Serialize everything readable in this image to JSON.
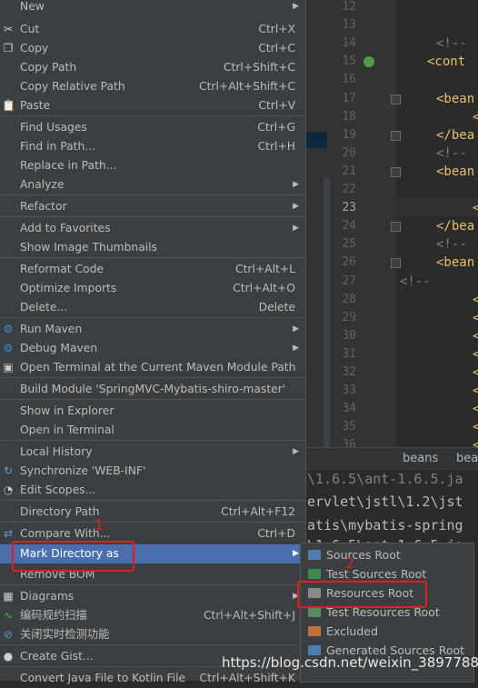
{
  "colors": {
    "menu_bg": "#3c3f41",
    "selection": "#4b6eaf",
    "highlight": "#e02020",
    "editor_bg": "#2b2b2b",
    "tag": "#e8bf6a",
    "comment": "#808080"
  },
  "editor": {
    "line_numbers": [
      "12",
      "13",
      "14",
      "15",
      "16",
      "17",
      "18",
      "19",
      "20",
      "21",
      "22",
      "23",
      "24",
      "25",
      "26",
      "27",
      "28",
      "29",
      "30",
      "31",
      "32",
      "33",
      "34",
      "35",
      "36"
    ],
    "lines": [
      "",
      "",
      "<!--",
      "<cont",
      "",
      "<bean",
      "<",
      "</bea",
      "<!--",
      "<bean",
      "",
      "<",
      "</bea",
      "<!--",
      "<bean",
      "<!--",
      "<",
      "<",
      "<",
      "<",
      "<",
      "<",
      "<",
      "<",
      "<"
    ]
  },
  "breadcrumb": {
    "items": [
      "beans",
      "bear"
    ]
  },
  "console": {
    "lines": [
      "\\1.6.5\\ant-1.6.5.ja",
      "ervlet\\jstl\\1.2\\jst",
      "atis\\mybatis-spring",
      "\\1.6.5\\ant-1.6.5.ja"
    ]
  },
  "menu": {
    "items": [
      {
        "label": "New",
        "shortcut": "",
        "arrow": true,
        "icon": ""
      },
      {
        "label": "Cut",
        "shortcut": "Ctrl+X",
        "arrow": false,
        "icon": "scissors-icon"
      },
      {
        "label": "Copy",
        "shortcut": "Ctrl+C",
        "arrow": false,
        "icon": "copy-icon"
      },
      {
        "label": "Copy Path",
        "shortcut": "Ctrl+Shift+C",
        "arrow": false,
        "icon": ""
      },
      {
        "label": "Copy Relative Path",
        "shortcut": "Ctrl+Alt+Shift+C",
        "arrow": false,
        "icon": ""
      },
      {
        "label": "Paste",
        "shortcut": "Ctrl+V",
        "arrow": false,
        "icon": "paste-icon"
      },
      {
        "label": "Find Usages",
        "shortcut": "Ctrl+G",
        "arrow": false,
        "icon": ""
      },
      {
        "label": "Find in Path...",
        "shortcut": "Ctrl+H",
        "arrow": false,
        "icon": ""
      },
      {
        "label": "Replace in Path...",
        "shortcut": "",
        "arrow": false,
        "icon": ""
      },
      {
        "label": "Analyze",
        "shortcut": "",
        "arrow": true,
        "icon": ""
      },
      {
        "label": "Refactor",
        "shortcut": "",
        "arrow": true,
        "icon": ""
      },
      {
        "label": "Add to Favorites",
        "shortcut": "",
        "arrow": true,
        "icon": ""
      },
      {
        "label": "Show Image Thumbnails",
        "shortcut": "",
        "arrow": false,
        "icon": ""
      },
      {
        "label": "Reformat Code",
        "shortcut": "Ctrl+Alt+L",
        "arrow": false,
        "icon": ""
      },
      {
        "label": "Optimize Imports",
        "shortcut": "Ctrl+Alt+O",
        "arrow": false,
        "icon": ""
      },
      {
        "label": "Delete...",
        "shortcut": "Delete",
        "arrow": false,
        "icon": ""
      },
      {
        "label": "Run Maven",
        "shortcut": "",
        "arrow": true,
        "icon": "maven-gear-icon"
      },
      {
        "label": "Debug Maven",
        "shortcut": "",
        "arrow": true,
        "icon": "maven-gear-icon"
      },
      {
        "label": "Open Terminal at the Current Maven Module Path",
        "shortcut": "",
        "arrow": false,
        "icon": "terminal-icon"
      },
      {
        "label": "Build Module 'SpringMVC-Mybatis-shiro-master'",
        "shortcut": "",
        "arrow": false,
        "icon": ""
      },
      {
        "label": "Show in Explorer",
        "shortcut": "",
        "arrow": false,
        "icon": ""
      },
      {
        "label": "Open in Terminal",
        "shortcut": "",
        "arrow": false,
        "icon": ""
      },
      {
        "label": "Local History",
        "shortcut": "",
        "arrow": true,
        "icon": ""
      },
      {
        "label": "Synchronize 'WEB-INF'",
        "shortcut": "",
        "arrow": false,
        "icon": "sync-icon"
      },
      {
        "label": "Edit Scopes...",
        "shortcut": "",
        "arrow": false,
        "icon": "edit-scopes-icon"
      },
      {
        "label": "Directory Path",
        "shortcut": "Ctrl+Alt+F12",
        "arrow": false,
        "icon": ""
      },
      {
        "label": "Compare With...",
        "shortcut": "Ctrl+D",
        "arrow": false,
        "icon": "compare-icon"
      },
      {
        "label": "Mark Directory as",
        "shortcut": "",
        "arrow": true,
        "icon": ""
      },
      {
        "label": "Remove BOM",
        "shortcut": "",
        "arrow": false,
        "icon": ""
      },
      {
        "label": "Diagrams",
        "shortcut": "",
        "arrow": true,
        "icon": "diagram-icon"
      },
      {
        "label": "编码规约扫描",
        "shortcut": "Ctrl+Alt+Shift+J",
        "arrow": false,
        "icon": "scan-icon"
      },
      {
        "label": "关闭实时检测功能",
        "shortcut": "",
        "arrow": false,
        "icon": "disable-icon"
      },
      {
        "label": "Create Gist...",
        "shortcut": "",
        "arrow": false,
        "icon": "github-icon"
      },
      {
        "label": "Convert Java File to Kotlin File",
        "shortcut": "Ctrl+Alt+Shift+K",
        "arrow": false,
        "icon": ""
      }
    ]
  },
  "submenu": {
    "items": [
      {
        "label": "Sources Root",
        "folder_color": "#4b7fb0"
      },
      {
        "label": "Test Sources Root",
        "folder_color": "#3f8a4a"
      },
      {
        "label": "Resources Root",
        "folder_color": "#8a8a8a"
      },
      {
        "label": "Test Resources Root",
        "folder_color": "#5e8b5e"
      },
      {
        "label": "Excluded",
        "folder_color": "#c0703a"
      },
      {
        "label": "Generated Sources Root",
        "folder_color": "#4b7fb0"
      }
    ]
  },
  "annotations": {
    "step1": "1",
    "step2": "2"
  },
  "watermark": "https://blog.csdn.net/weixin_38977885"
}
